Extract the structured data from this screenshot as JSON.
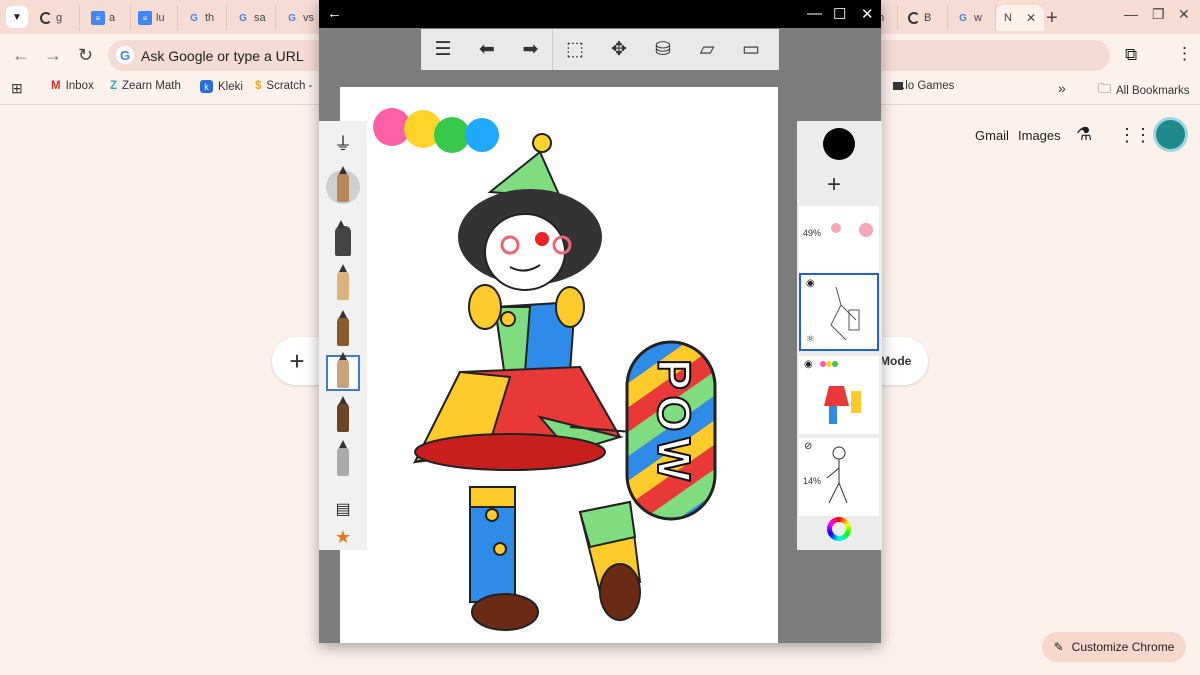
{
  "tabs": [
    {
      "label": "g",
      "favicon": "spinner-icon"
    },
    {
      "label": "a",
      "favicon": "docs-icon"
    },
    {
      "label": "lu",
      "favicon": "docs-icon"
    },
    {
      "label": "th",
      "favicon": "google-icon"
    },
    {
      "label": "sa",
      "favicon": "google-icon"
    },
    {
      "label": "vs",
      "favicon": "google-icon"
    },
    {
      "label": "h",
      "favicon": "none"
    },
    {
      "label": "B",
      "favicon": "spinner-icon"
    },
    {
      "label": "w",
      "favicon": "google-icon"
    },
    {
      "label": "N",
      "favicon": "none",
      "active": true
    }
  ],
  "omnibox": {
    "placeholder": "Ask Google or type a URL"
  },
  "bookmarks": [
    {
      "label": "Inbox",
      "icon": "gmail-icon"
    },
    {
      "label": "Zearn Math",
      "icon": "zearn-icon"
    },
    {
      "label": "Kleki",
      "icon": "kleki-icon"
    },
    {
      "label": "Scratch -",
      "icon": "scratch-icon"
    },
    {
      "label": ".lo Games",
      "icon": "game-icon"
    }
  ],
  "bookmarks_more": "»",
  "all_bookmarks": "All Bookmarks",
  "ntp": {
    "gmail": "Gmail",
    "images": "Images",
    "mode": "Mode",
    "customize": "Customize Chrome"
  },
  "app": {
    "layers": [
      {
        "opacity_label": "49%",
        "visible": true
      },
      {
        "opacity_label": "",
        "visible": true,
        "selected": true
      },
      {
        "opacity_label": "",
        "visible": true
      },
      {
        "opacity_label": "14%",
        "visible": false
      }
    ],
    "canvas_text": "POW",
    "current_color": "#000000"
  }
}
